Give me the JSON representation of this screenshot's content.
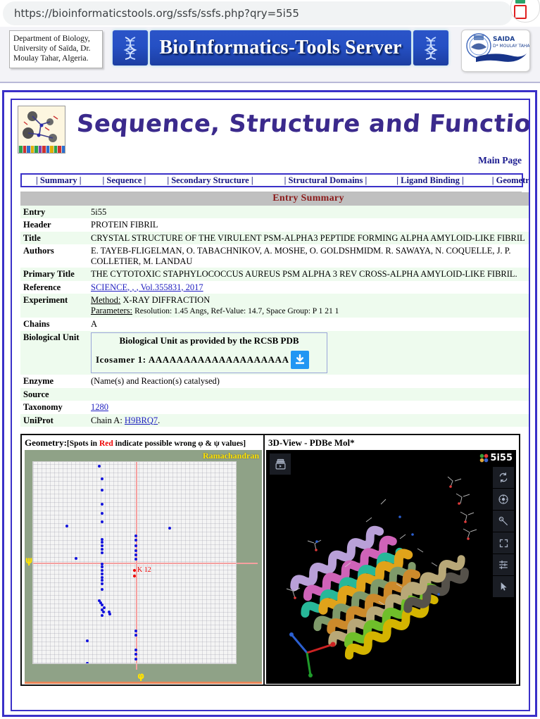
{
  "browser": {
    "url": "https://bioinformaticstools.org/ssfs/ssfs.php?qry=5i55",
    "extension_icon": "extension-icon"
  },
  "banner": {
    "department": "Department of Biology, University of Saïda, Dr. Moulay Tahar, Algeria.",
    "server_title": "BioInformatics-Tools Server",
    "left_icon": "dna-icon",
    "right_icon": "dna-icon",
    "university_logo": "university-logo"
  },
  "site": {
    "title": "Sequence, Structure and Function Server",
    "thumbnail": "molecule-thumbnail",
    "main_page_link": "Main Page"
  },
  "nav": {
    "items": [
      {
        "label": "| Summary |",
        "name": "tab-summary"
      },
      {
        "label": "| Sequence |",
        "name": "tab-sequence"
      },
      {
        "label": "| Secondary Structure |",
        "name": "tab-secondary-structure"
      },
      {
        "label": "| Structural Domains |",
        "name": "tab-structural-domains"
      },
      {
        "label": "| Ligand Binding |",
        "name": "tab-ligand-binding"
      },
      {
        "label": "| Geometry |",
        "name": "tab-geometry"
      }
    ]
  },
  "summary": {
    "heading": "Entry Summary",
    "rows": {
      "entry_label": "Entry",
      "entry_value": "5i55",
      "header_label": "Header",
      "header_value": "PROTEIN FIBRIL",
      "title_label": "Title",
      "title_value": "CRYSTAL STRUCTURE OF THE VIRULENT PSM-ALPHA3 PEPTIDE FORMING ALPHA AMYLOID-LIKE FIBRIL",
      "authors_label": "Authors",
      "authors_value": "E. TAYEB-FLIGELMAN, O. TABACHNIKOV, A. MOSHE, O. GOLDSHMIDM. R. SAWAYA, N. COQUELLE, J. P. COLLETIER, M. LANDAU",
      "primary_title_label": "Primary Title",
      "primary_title_value": "THE CYTOTOXIC STAPHYLOCOCCUS AUREUS PSM ALPHA 3 REV CROSS-ALPHA AMYLOID-LIKE FIBRIL.",
      "reference_label": "Reference",
      "reference_value": "SCIENCE, , , Vol.355831, 2017",
      "experiment_label": "Experiment",
      "experiment_method_key": "Method:",
      "experiment_method_value": "X-RAY DIFFRACTION",
      "experiment_params_key": "Parameters:",
      "experiment_params_value": "Resolution: 1.45 Angs, Ref-Value: 14.7, Space Group: P 1 21 1",
      "chains_label": "Chains",
      "chains_value": "A",
      "biological_unit_label": "Biological Unit",
      "biological_unit_heading": "Biological Unit as provided by the RCSB PDB",
      "biological_unit_value": "Icosamer 1: AAAAAAAAAAAAAAAAAAAA",
      "download_icon": "download-icon",
      "enzyme_label": "Enzyme",
      "enzyme_value": "(Name(s) and Reaction(s) catalysed)",
      "source_label": "Source",
      "source_value": "",
      "taxonomy_label": "Taxonomy",
      "taxonomy_value": "1280",
      "uniprot_label": "UniProt",
      "uniprot_prefix": "Chain A:",
      "uniprot_value": "H9BRQ7",
      "uniprot_suffix": "."
    }
  },
  "geometry_panel": {
    "heading_main": "Geometry:",
    "heading_rest_a": "[Spots in ",
    "heading_red": "Red",
    "heading_rest_b": " indicate possible wrong φ & ψ values]",
    "plot_label": "Ramachandran",
    "x_axis_label": "φ",
    "y_axis_label": "ψ",
    "outlier_label": "K 12"
  },
  "view3d_panel": {
    "heading": "3D-View - PDBe Mol*",
    "pdb_code": "5i55",
    "pdb_icon": "pdbe-logo-icon",
    "animate_icon": "animation-icon",
    "tools": [
      {
        "name": "reset-camera-icon",
        "label": "Reset"
      },
      {
        "name": "focus-target-icon",
        "label": "Focus"
      },
      {
        "name": "screenshot-icon",
        "label": "Screenshot"
      },
      {
        "name": "fullscreen-icon",
        "label": "Fullscreen"
      },
      {
        "name": "settings-sliders-icon",
        "label": "Settings"
      },
      {
        "name": "cursor-select-icon",
        "label": "Select"
      }
    ]
  },
  "chart_data": {
    "type": "scatter",
    "title": "Ramachandran",
    "xlabel": "φ",
    "ylabel": "ψ",
    "xlim": [
      -180,
      180
    ],
    "ylim": [
      -180,
      180
    ],
    "grid": true,
    "legend": "none",
    "series": [
      {
        "name": "residues",
        "color": "#1414dd",
        "points": [
          [
            -62,
            172
          ],
          [
            -58,
            150
          ],
          [
            -58,
            130
          ],
          [
            -58,
            105
          ],
          [
            -58,
            88
          ],
          [
            -58,
            73
          ],
          [
            -120,
            66
          ],
          [
            -58,
            42
          ],
          [
            -58,
            36
          ],
          [
            -58,
            30
          ],
          [
            -58,
            24
          ],
          [
            -58,
            18
          ],
          [
            -104,
            8
          ],
          [
            -58,
            -2
          ],
          [
            -58,
            -8
          ],
          [
            -58,
            -14
          ],
          [
            -58,
            -20
          ],
          [
            -58,
            -26
          ],
          [
            -58,
            -32
          ],
          [
            -58,
            -38
          ],
          [
            -58,
            -48
          ],
          [
            -62,
            -68
          ],
          [
            -60,
            -72
          ],
          [
            -57,
            -76
          ],
          [
            -54,
            -80
          ],
          [
            -58,
            -84
          ],
          [
            -55,
            -88
          ],
          [
            -45,
            -88
          ],
          [
            -44,
            -92
          ],
          [
            -57,
            -95
          ],
          [
            -84,
            -140
          ],
          [
            -84,
            -180
          ],
          [
            2,
            48
          ],
          [
            2,
            40
          ],
          [
            2,
            30
          ],
          [
            2,
            22
          ],
          [
            2,
            14
          ],
          [
            2,
            6
          ],
          [
            63,
            62
          ],
          [
            2,
            -122
          ],
          [
            2,
            -130
          ],
          [
            2,
            -156
          ],
          [
            2,
            -164
          ],
          [
            2,
            -172
          ]
        ]
      },
      {
        "name": "outliers",
        "color": "#ee0000",
        "labels": [
          "K 12"
        ],
        "points": [
          [
            0,
            -14
          ],
          [
            0,
            -24
          ]
        ]
      }
    ]
  }
}
